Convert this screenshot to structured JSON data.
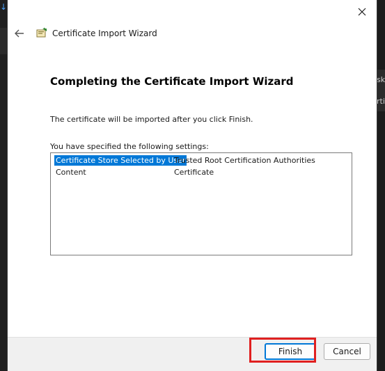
{
  "background": {
    "right_text_1": "sk",
    "right_text_2": "rti"
  },
  "dialog": {
    "title": "Certificate Import Wizard",
    "heading": "Completing the Certificate Import Wizard",
    "intro": "The certificate will be imported after you click Finish.",
    "settings_label": "You have specified the following settings:",
    "settings": [
      {
        "key": "Certificate Store Selected by User",
        "value": "Trusted Root Certification Authorities"
      },
      {
        "key": "Content",
        "value": "Certificate"
      }
    ],
    "buttons": {
      "finish": "Finish",
      "cancel": "Cancel"
    }
  },
  "colors": {
    "selection": "#0078d7",
    "highlight": "#e02020"
  }
}
